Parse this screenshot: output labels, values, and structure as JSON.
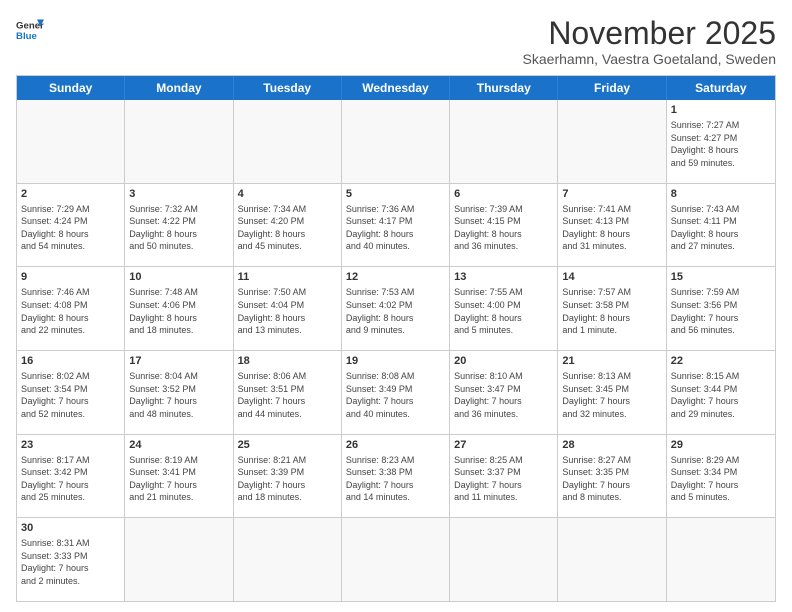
{
  "header": {
    "logo_general": "General",
    "logo_blue": "Blue",
    "month": "November 2025",
    "location": "Skaerhamn, Vaestra Goetaland, Sweden"
  },
  "weekdays": [
    "Sunday",
    "Monday",
    "Tuesday",
    "Wednesday",
    "Thursday",
    "Friday",
    "Saturday"
  ],
  "weeks": [
    [
      {
        "day": "",
        "info": ""
      },
      {
        "day": "",
        "info": ""
      },
      {
        "day": "",
        "info": ""
      },
      {
        "day": "",
        "info": ""
      },
      {
        "day": "",
        "info": ""
      },
      {
        "day": "",
        "info": ""
      },
      {
        "day": "1",
        "info": "Sunrise: 7:27 AM\nSunset: 4:27 PM\nDaylight: 8 hours\nand 59 minutes."
      }
    ],
    [
      {
        "day": "2",
        "info": "Sunrise: 7:29 AM\nSunset: 4:24 PM\nDaylight: 8 hours\nand 54 minutes."
      },
      {
        "day": "3",
        "info": "Sunrise: 7:32 AM\nSunset: 4:22 PM\nDaylight: 8 hours\nand 50 minutes."
      },
      {
        "day": "4",
        "info": "Sunrise: 7:34 AM\nSunset: 4:20 PM\nDaylight: 8 hours\nand 45 minutes."
      },
      {
        "day": "5",
        "info": "Sunrise: 7:36 AM\nSunset: 4:17 PM\nDaylight: 8 hours\nand 40 minutes."
      },
      {
        "day": "6",
        "info": "Sunrise: 7:39 AM\nSunset: 4:15 PM\nDaylight: 8 hours\nand 36 minutes."
      },
      {
        "day": "7",
        "info": "Sunrise: 7:41 AM\nSunset: 4:13 PM\nDaylight: 8 hours\nand 31 minutes."
      },
      {
        "day": "8",
        "info": "Sunrise: 7:43 AM\nSunset: 4:11 PM\nDaylight: 8 hours\nand 27 minutes."
      }
    ],
    [
      {
        "day": "9",
        "info": "Sunrise: 7:46 AM\nSunset: 4:08 PM\nDaylight: 8 hours\nand 22 minutes."
      },
      {
        "day": "10",
        "info": "Sunrise: 7:48 AM\nSunset: 4:06 PM\nDaylight: 8 hours\nand 18 minutes."
      },
      {
        "day": "11",
        "info": "Sunrise: 7:50 AM\nSunset: 4:04 PM\nDaylight: 8 hours\nand 13 minutes."
      },
      {
        "day": "12",
        "info": "Sunrise: 7:53 AM\nSunset: 4:02 PM\nDaylight: 8 hours\nand 9 minutes."
      },
      {
        "day": "13",
        "info": "Sunrise: 7:55 AM\nSunset: 4:00 PM\nDaylight: 8 hours\nand 5 minutes."
      },
      {
        "day": "14",
        "info": "Sunrise: 7:57 AM\nSunset: 3:58 PM\nDaylight: 8 hours\nand 1 minute."
      },
      {
        "day": "15",
        "info": "Sunrise: 7:59 AM\nSunset: 3:56 PM\nDaylight: 7 hours\nand 56 minutes."
      }
    ],
    [
      {
        "day": "16",
        "info": "Sunrise: 8:02 AM\nSunset: 3:54 PM\nDaylight: 7 hours\nand 52 minutes."
      },
      {
        "day": "17",
        "info": "Sunrise: 8:04 AM\nSunset: 3:52 PM\nDaylight: 7 hours\nand 48 minutes."
      },
      {
        "day": "18",
        "info": "Sunrise: 8:06 AM\nSunset: 3:51 PM\nDaylight: 7 hours\nand 44 minutes."
      },
      {
        "day": "19",
        "info": "Sunrise: 8:08 AM\nSunset: 3:49 PM\nDaylight: 7 hours\nand 40 minutes."
      },
      {
        "day": "20",
        "info": "Sunrise: 8:10 AM\nSunset: 3:47 PM\nDaylight: 7 hours\nand 36 minutes."
      },
      {
        "day": "21",
        "info": "Sunrise: 8:13 AM\nSunset: 3:45 PM\nDaylight: 7 hours\nand 32 minutes."
      },
      {
        "day": "22",
        "info": "Sunrise: 8:15 AM\nSunset: 3:44 PM\nDaylight: 7 hours\nand 29 minutes."
      }
    ],
    [
      {
        "day": "23",
        "info": "Sunrise: 8:17 AM\nSunset: 3:42 PM\nDaylight: 7 hours\nand 25 minutes."
      },
      {
        "day": "24",
        "info": "Sunrise: 8:19 AM\nSunset: 3:41 PM\nDaylight: 7 hours\nand 21 minutes."
      },
      {
        "day": "25",
        "info": "Sunrise: 8:21 AM\nSunset: 3:39 PM\nDaylight: 7 hours\nand 18 minutes."
      },
      {
        "day": "26",
        "info": "Sunrise: 8:23 AM\nSunset: 3:38 PM\nDaylight: 7 hours\nand 14 minutes."
      },
      {
        "day": "27",
        "info": "Sunrise: 8:25 AM\nSunset: 3:37 PM\nDaylight: 7 hours\nand 11 minutes."
      },
      {
        "day": "28",
        "info": "Sunrise: 8:27 AM\nSunset: 3:35 PM\nDaylight: 7 hours\nand 8 minutes."
      },
      {
        "day": "29",
        "info": "Sunrise: 8:29 AM\nSunset: 3:34 PM\nDaylight: 7 hours\nand 5 minutes."
      }
    ],
    [
      {
        "day": "30",
        "info": "Sunrise: 8:31 AM\nSunset: 3:33 PM\nDaylight: 7 hours\nand 2 minutes."
      },
      {
        "day": "",
        "info": ""
      },
      {
        "day": "",
        "info": ""
      },
      {
        "day": "",
        "info": ""
      },
      {
        "day": "",
        "info": ""
      },
      {
        "day": "",
        "info": ""
      },
      {
        "day": "",
        "info": ""
      }
    ]
  ]
}
